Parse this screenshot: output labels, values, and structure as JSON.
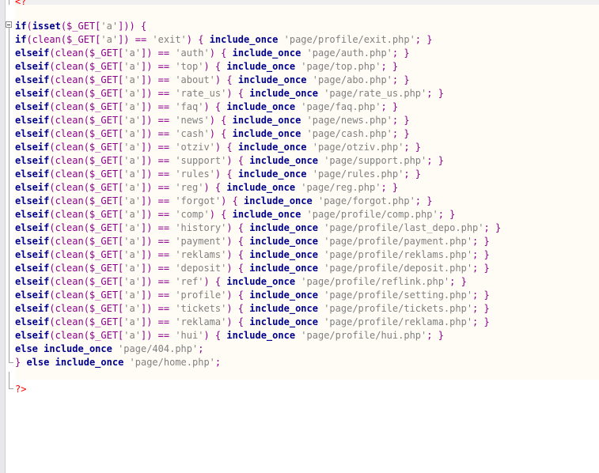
{
  "editor": {
    "language": "PHP",
    "top_tag": "<?",
    "close_tag": "?>",
    "line1": {
      "kw": "if",
      "open": "(",
      "fn": "isset",
      "arg": "($_GET[",
      "str": "'a'",
      "close": "])) {"
    },
    "first_branch": {
      "kw": "if",
      "call": "(clean($_GET[",
      "key": "'a'",
      "mid": "]) == ",
      "val": "'exit'",
      "brace": ") { ",
      "inc": "include_once",
      "sp": " ",
      "path": "'page/profile/exit.php'",
      "end": "; }"
    },
    "branches": [
      {
        "val": "'auth'",
        "path": "'page/auth.php'"
      },
      {
        "val": "'top'",
        "path": "'page/top.php'"
      },
      {
        "val": "'about'",
        "path": "'page/abo.php'"
      },
      {
        "val": "'rate_us'",
        "path": "'page/rate_us.php'"
      },
      {
        "val": "'faq'",
        "path": "'page/faq.php'"
      },
      {
        "val": "'news'",
        "path": "'page/news.php'"
      },
      {
        "val": "'cash'",
        "path": "'page/cash.php'"
      },
      {
        "val": "'otziv'",
        "path": "'page/otziv.php'"
      },
      {
        "val": "'support'",
        "path": "'page/support.php'"
      },
      {
        "val": "'rules'",
        "path": "'page/rules.php'"
      },
      {
        "val": "'reg'",
        "path": "'page/reg.php'"
      },
      {
        "val": "'forgot'",
        "path": "'page/forgot.php'"
      },
      {
        "val": "'comp'",
        "path": "'page/profile/comp.php'"
      },
      {
        "val": "'history'",
        "path": "'page/profile/last_depo.php'"
      },
      {
        "val": "'payment'",
        "path": "'page/profile/payment.php'"
      },
      {
        "val": "'reklams'",
        "path": "'page/profile/reklams.php'"
      },
      {
        "val": "'deposit'",
        "path": "'page/profile/deposit.php'"
      },
      {
        "val": "'ref'",
        "path": "'page/profile/reflink.php'"
      },
      {
        "val": "'profile'",
        "path": "'page/profile/setting.php'"
      },
      {
        "val": "'tickets'",
        "path": "'page/profile/tickets.php'"
      },
      {
        "val": "'reklama'",
        "path": "'page/profile/reklama.php'"
      },
      {
        "val": "'hui'",
        "path": "'page/profile/hui.php'"
      }
    ],
    "else_line": {
      "kw": "else",
      "inc": "include_once",
      "path": "'page/404.php'",
      "end": ";"
    },
    "outer_else": {
      "open": "} ",
      "kw": "else",
      "inc": "include_once",
      "path": "'page/home.php'",
      "end": ";"
    },
    "tokens": {
      "elseif": "elseif",
      "clean_open": "(clean($_GET[",
      "key": "'a'",
      "eq": "]) == ",
      "brace_open": ") { ",
      "include_once": "include_once",
      "semi_close": "; }"
    }
  }
}
